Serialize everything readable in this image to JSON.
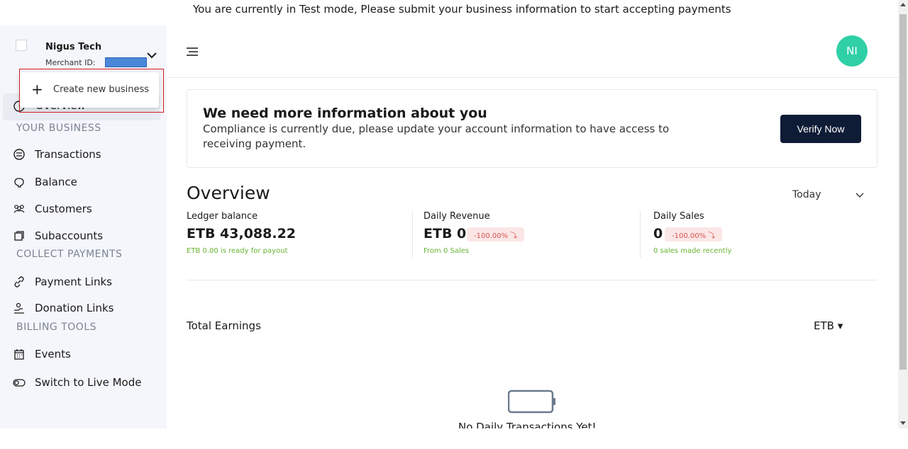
{
  "banner": {
    "text": "You are currently in Test mode, Please submit your business information to start accepting payments"
  },
  "business": {
    "name": "Nigus Tech",
    "merchant_id_label": "Merchant ID:"
  },
  "dropdown": {
    "create_label": "Create new business"
  },
  "sidebar": {
    "overview_label": "Overview",
    "sections": [
      {
        "heading": "YOUR BUSINESS"
      },
      {
        "heading": "COLLECT PAYMENTS"
      },
      {
        "heading": "BILLING TOOLS"
      }
    ],
    "items": [
      {
        "label": "Transactions",
        "icon": "transactions-icon"
      },
      {
        "label": "Balance",
        "icon": "piggy-bank-icon"
      },
      {
        "label": "Customers",
        "icon": "customers-icon"
      },
      {
        "label": "Subaccounts",
        "icon": "subaccounts-icon"
      },
      {
        "label": "Payment Links",
        "icon": "link-icon"
      },
      {
        "label": "Donation Links",
        "icon": "donation-icon"
      },
      {
        "label": "Events",
        "icon": "calendar-icon"
      },
      {
        "label": "Switch to Live Mode",
        "icon": "toggle-icon"
      }
    ]
  },
  "header": {
    "avatar_initials": "NI"
  },
  "info_card": {
    "title": "We need more information about you",
    "description": "Compliance is currently due, please update your account information to have access to receiving payment.",
    "button_label": "Verify Now"
  },
  "overview": {
    "title": "Overview",
    "period": "Today",
    "stats": [
      {
        "label": "Ledger balance",
        "value": "ETB 43,088.22",
        "sub": "ETB 0.00 is ready for payout"
      },
      {
        "label": "Daily Revenue",
        "value": "ETB 0",
        "badge": "-100.00% ⤵",
        "sub": "From 0 Sales"
      },
      {
        "label": "Daily Sales",
        "value": "0",
        "badge": "-100.00% ⤵",
        "sub": "0 sales made recently"
      }
    ]
  },
  "earnings": {
    "title": "Total Earnings",
    "currency": "ETB ▾",
    "empty_text": "No Daily Transactions Yet!"
  },
  "colors": {
    "accent": "#0f1c36",
    "avatar": "#2fd0a5",
    "positive": "#67b332",
    "negative": "#d9534f"
  }
}
